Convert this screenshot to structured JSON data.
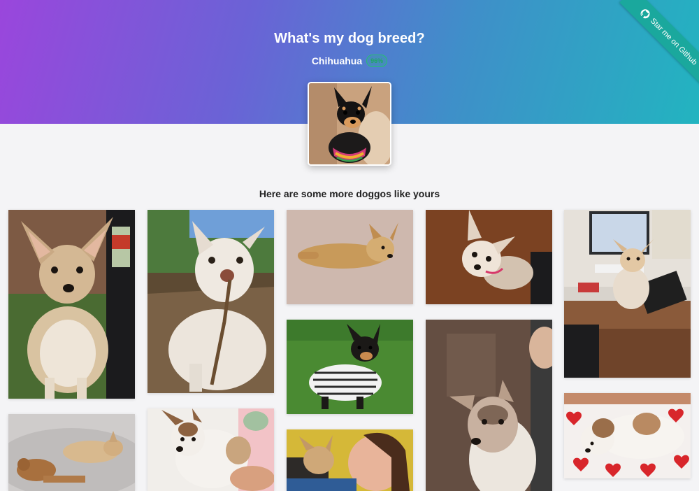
{
  "header": {
    "title": "What's my dog breed?",
    "breed": "Chihuahua",
    "confidence": "96%"
  },
  "ribbon": {
    "label": "Star me on Github",
    "icon": "github-icon"
  },
  "uploaded_photo": {
    "name": "uploaded-dog-photo"
  },
  "gallery": {
    "heading": "Here are some more doggos like yours",
    "photos": [
      "chihuahua-standing-photo",
      "chihuahua-with-stick-photo",
      "chihuahua-lying-on-carpet-photo",
      "chihuahua-looking-up-photo",
      "chihuahua-on-desk-photo",
      "chihuahua-on-grass-in-shirt-photo",
      "chihuahua-puppy-close-up-photo",
      "chihuahua-sleeping-on-blanket-photo",
      "chihuahua-on-bed-with-toy-photo",
      "chihuahua-puppy-held-photo",
      "chihuahua-with-woman-photo"
    ]
  },
  "colors": {
    "gradient_start": "#9a46dc",
    "gradient_end": "#22b4c0",
    "ribbon": "#1aa89d",
    "badge": "#25c072",
    "background": "#f4f4f6"
  }
}
